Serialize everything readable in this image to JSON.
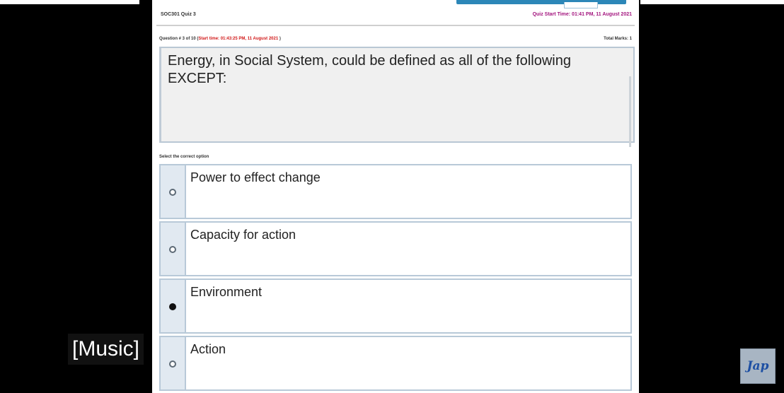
{
  "quiz": {
    "course_title": "SOC301 Quiz 3",
    "quiz_start_time": "Quiz Start Time: 01:41 PM, 11 August 2021",
    "question_number": "Question # 3 of 10 (",
    "question_start_time": "Start time: 01:43:25 PM, 11 August 2021",
    "question_meta_close": " )",
    "total_marks": "Total Marks: 1",
    "question_text": "Energy, in Social System, could be defined as all of the following EXCEPT:",
    "select_label": "Select the correct option",
    "options": [
      {
        "label": "Power to effect change",
        "selected": false
      },
      {
        "label": "Capacity for action",
        "selected": false
      },
      {
        "label": "Environment",
        "selected": true
      },
      {
        "label": "Action",
        "selected": false
      }
    ]
  },
  "overlay": {
    "caption": "[Music]",
    "logo": "Jap"
  },
  "colors": {
    "start_time": "#a3147e",
    "question_time": "#d11818",
    "option_border": "#b8c9d8",
    "radio_cell": "#e1e9f1"
  }
}
